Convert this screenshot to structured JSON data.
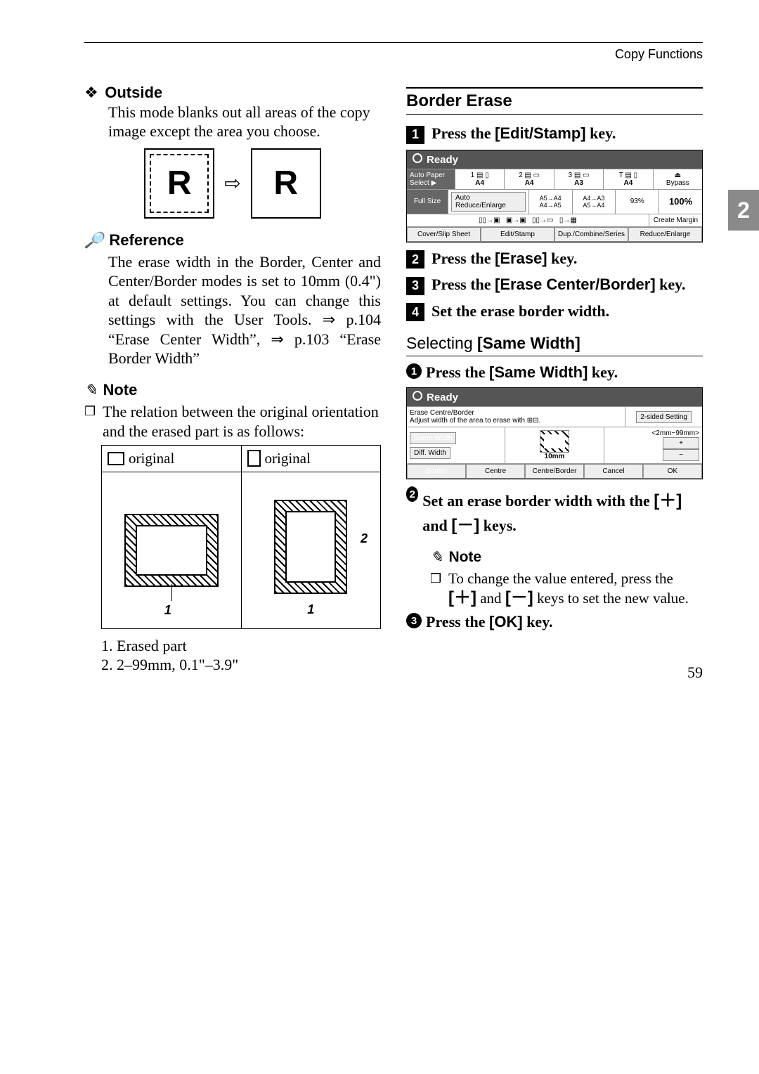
{
  "header": {
    "section": "Copy Functions"
  },
  "tab": "2",
  "page_number": "59",
  "left": {
    "outside": {
      "title": "Outside",
      "desc": "This mode blanks out all areas of the copy image except the area you choose.",
      "r": "R"
    },
    "reference": {
      "title": "Reference",
      "body": "The erase width in the Border, Center and Center/Border modes is set to 10mm (0.4\") at default settings. You can change this settings with the User Tools. ⇒ p.104 “Erase Center Width”, ⇒ p.103 “Erase Border Width”"
    },
    "note": {
      "title": "Note",
      "item": "The relation between the original orientation and the erased part is as follows:",
      "col1": "original",
      "col2": "original",
      "one": "1",
      "two": "2",
      "erased_label": "1. Erased part",
      "range_label": "2. 2–99mm, 0.1\"–3.9\""
    }
  },
  "right": {
    "section_title": "Border Erase",
    "steps": {
      "s1": "Press the ",
      "s1_key": "[Edit/Stamp]",
      "s1_tail": " key.",
      "s2": "Press the ",
      "s2_key": "[Erase]",
      "s2_tail": " key.",
      "s3": "Press the ",
      "s3_key": "[Erase Center/Border]",
      "s3_tail": " key.",
      "s4": "Set the erase border width."
    },
    "lcd1": {
      "ready": "Ready",
      "auto_paper": "Auto Paper Select ▶",
      "p1": "A4",
      "p2": "A4",
      "p3": "A3",
      "p4": "A4",
      "bypass": "Bypass",
      "full_size": "Full Size",
      "are": "Auto Reduce/Enlarge",
      "r1": "A5→A4\nA4→A5",
      "r2": "A4→A3\nA5→A4",
      "ratio": "93%",
      "hundred": "100%",
      "create": "Create Margin",
      "b1": "Cover/Slip Sheet",
      "b2": "Edit/Stamp",
      "b3": "Dup./Combine/Series",
      "b4": "Reduce/Enlarge"
    },
    "sub_heading_prefix": "Selecting ",
    "sub_heading_key": "[Same Width]",
    "c1": "Press the ",
    "c1_key": "[Same Width]",
    "c1_tail": " key.",
    "lcd2": {
      "ready": "Ready",
      "title": "Erase Centre/Border",
      "sub": "Adjust width of the area to erase with ",
      "range": "<2mm~99mm>",
      "same_width": "Same Width",
      "diff_width": "Diff. Width",
      "val": "10mm",
      "b1": "Border",
      "b2": "Centre",
      "b3": "Centre/Border",
      "b4": "Cancel",
      "b5": "OK",
      "two_sided": "2-sided Setting",
      "plus": "+",
      "minus": "−"
    },
    "c2_a": "Set an erase border width with the ",
    "c2_b": " and ",
    "c2_c": " keys.",
    "plus_key": "[＋]",
    "minus_key": "[－]",
    "note_title": "Note",
    "note_body_a": "To change the value entered, press the ",
    "note_body_b": " and ",
    "note_body_c": " keys to set the new value.",
    "c3": "Press the ",
    "c3_key": "[OK]",
    "c3_tail": " key."
  }
}
